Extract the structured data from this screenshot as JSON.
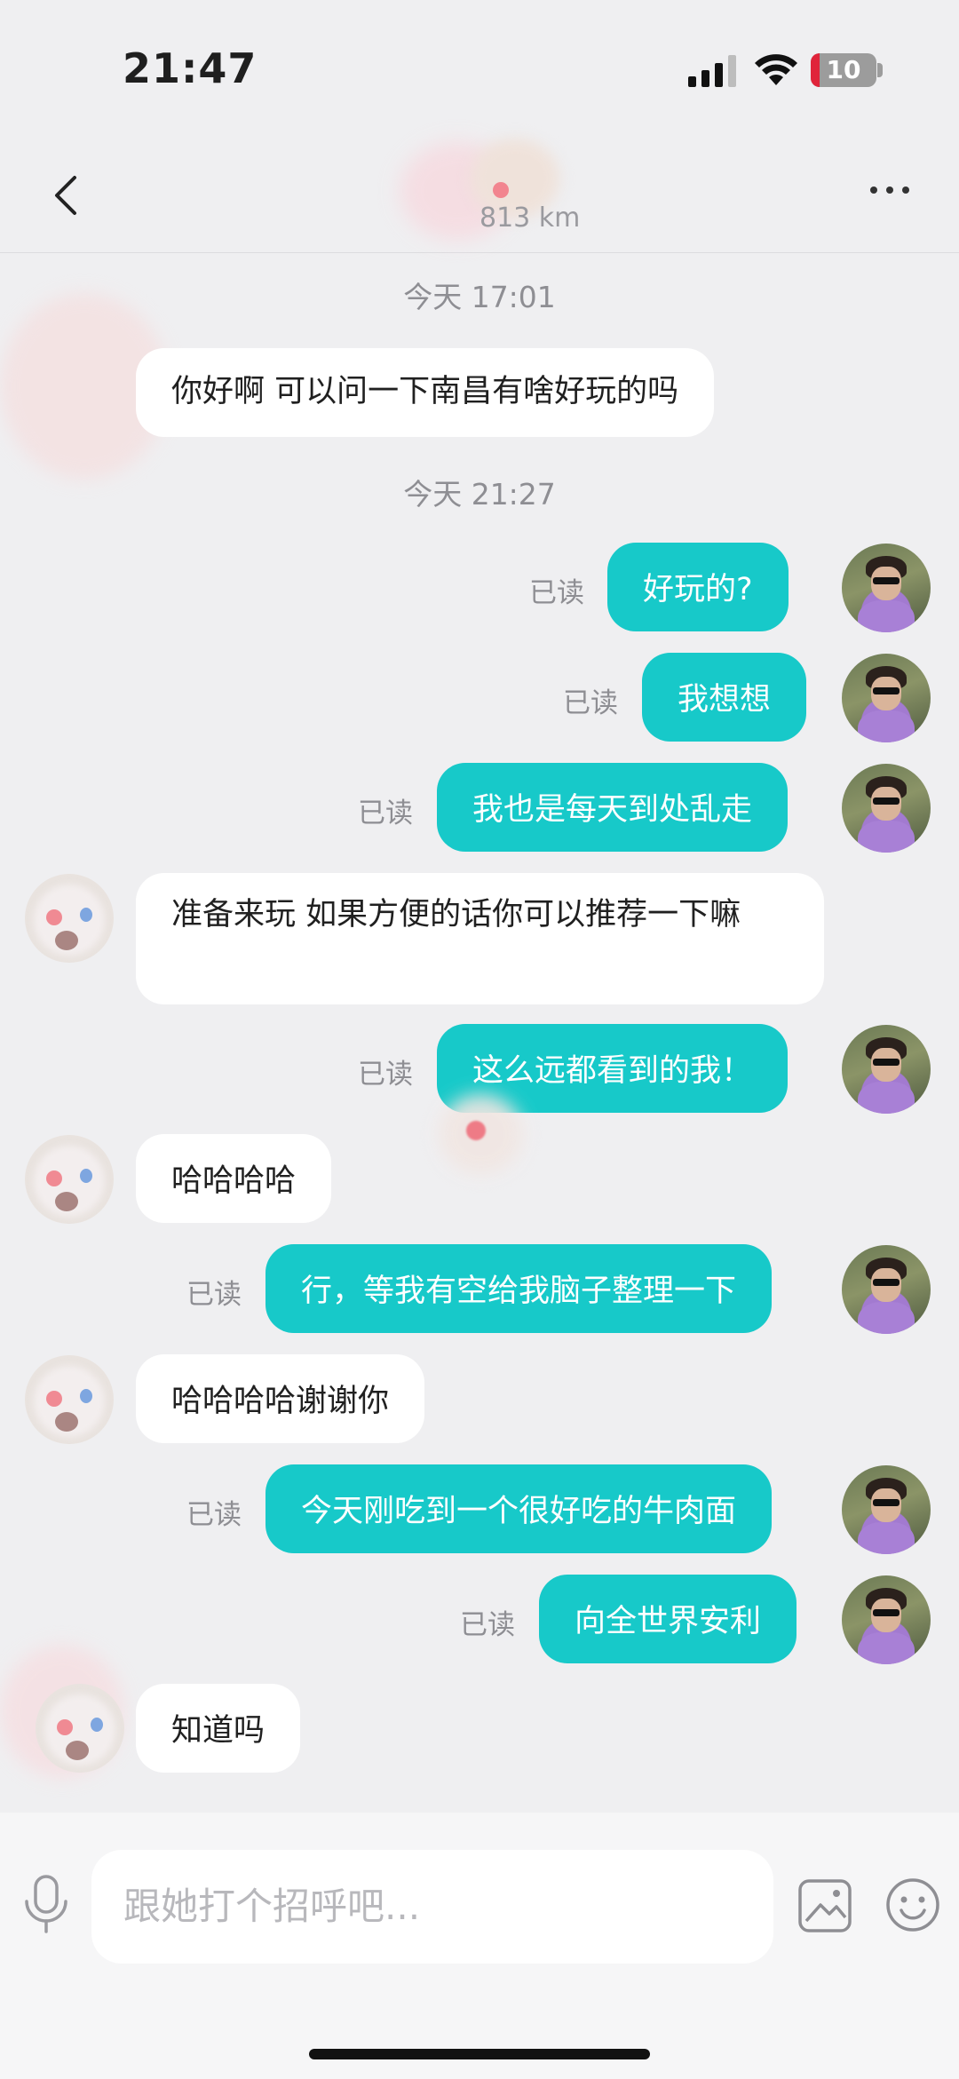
{
  "status_bar": {
    "time": "21:47",
    "battery": "10"
  },
  "nav": {
    "distance": "813 km"
  },
  "timestamps": [
    "今天 17:01",
    "今天 21:27"
  ],
  "read_label": "已读",
  "messages": [
    {
      "side": "in",
      "text": "你好啊 可以问一下南昌有啥好玩的吗"
    },
    {
      "side": "out",
      "text": "好玩的?"
    },
    {
      "side": "out",
      "text": "我想想"
    },
    {
      "side": "out",
      "text": "我也是每天到处乱走"
    },
    {
      "side": "in",
      "text": "准备来玩 如果方便的话你可以推荐一下嘛"
    },
    {
      "side": "out",
      "text": "这么远都看到的我！"
    },
    {
      "side": "in",
      "text": "哈哈哈哈"
    },
    {
      "side": "out",
      "text": "行，等我有空给我脑子整理一下"
    },
    {
      "side": "in",
      "text": "哈哈哈哈谢谢你"
    },
    {
      "side": "out",
      "text": "今天刚吃到一个很好吃的牛肉面"
    },
    {
      "side": "out",
      "text": "向全世界安利"
    },
    {
      "side": "in",
      "text": "知道吗"
    }
  ],
  "input": {
    "placeholder": "跟她打个招呼吧..."
  },
  "icons": {
    "back": "chevron-left-icon",
    "more": "more-dots-icon",
    "mic": "microphone-icon",
    "image": "image-icon",
    "emoji": "emoji-icon"
  },
  "colors": {
    "outgoing_bubble": "#17c9c9",
    "incoming_bubble": "#ffffff",
    "background": "#efeff1"
  }
}
